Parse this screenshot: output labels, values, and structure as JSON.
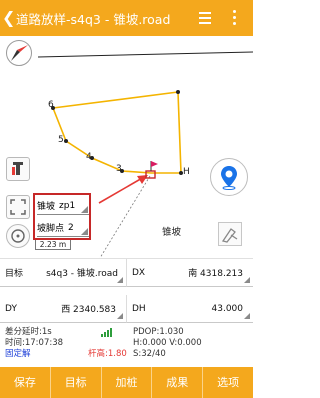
{
  "header": {
    "title": "道路放样-s4q3 - 锥坡.road"
  },
  "map": {
    "point_labels": [
      "6",
      "5",
      "4",
      "3",
      "H"
    ],
    "scale_label": "2.23 m",
    "feature_label": "锥坡"
  },
  "param_panel": {
    "row1_label": "锥坡",
    "row1_value": "zp1",
    "row2_label": "坡脚点",
    "row2_value": "2"
  },
  "info": {
    "target_label": "目标",
    "target_value": "s4q3 - 锥坡.road",
    "dx_label": "DX",
    "dx_value": "南 4318.213",
    "dy_label": "DY",
    "dy_value": "西 2340.583",
    "dh_label": "DH",
    "dh_value": "43.000",
    "diff_delay": "差分延时:1s",
    "time": "时间:17:07:38",
    "fix_status": "固定解",
    "pole_height": "杆高:1.80",
    "pdop": "PDOP:1.030",
    "hv": "H:0.000 V:0.000",
    "satellites": "S:32/40"
  },
  "bottom_bar": {
    "save": "保存",
    "target": "目标",
    "add_stake": "加桩",
    "results": "成果",
    "options": "选项"
  },
  "colors": {
    "accent": "#f4a81d",
    "polyline": "#f4b400",
    "fixed_text": "#1e40d8",
    "pole_height_text": "#e53935",
    "signal_green": "#2e9e3c",
    "locate_blue": "#1a73e8",
    "panel_border": "#c62828"
  }
}
